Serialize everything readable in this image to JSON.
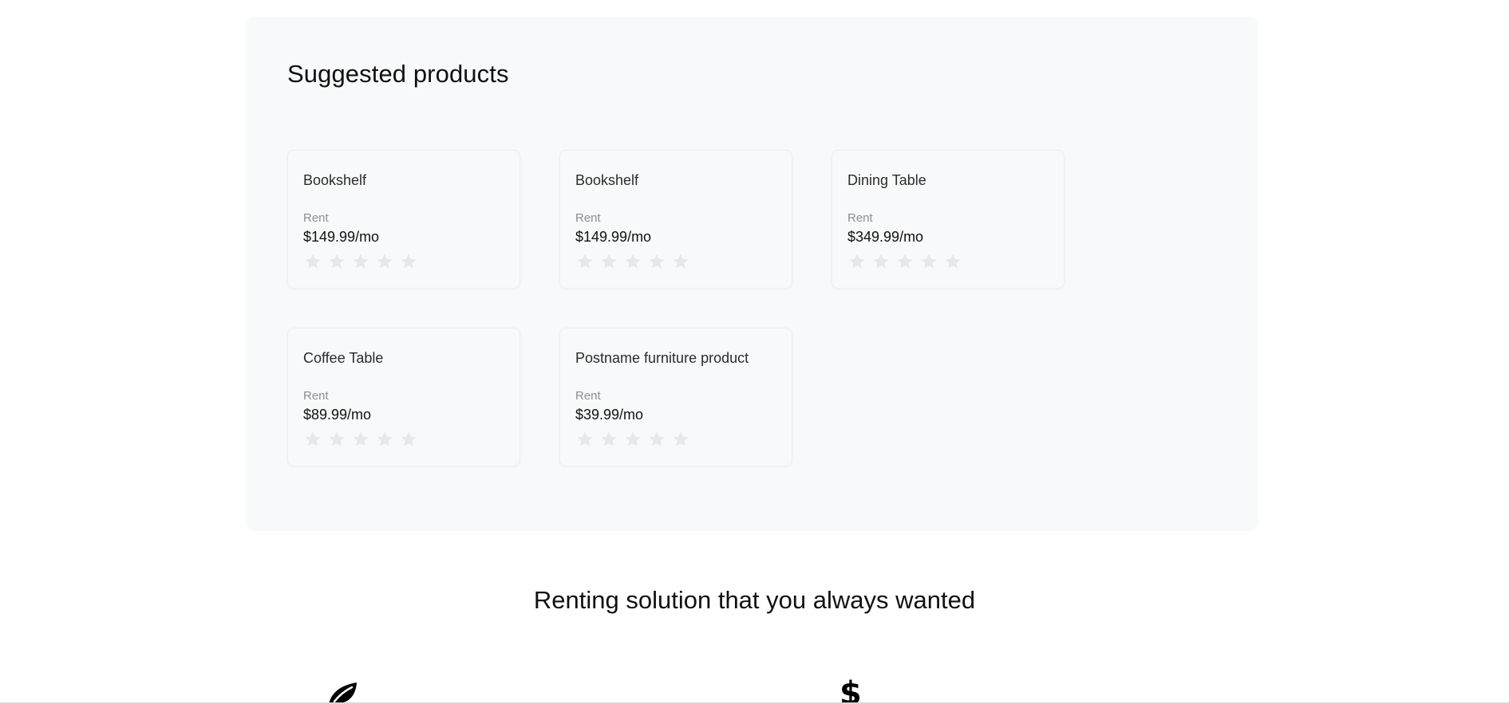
{
  "suggested": {
    "title": "Suggested products",
    "products": [
      {
        "name": "Bookshelf",
        "mode": "Rent",
        "price": "$149.99/mo",
        "rating": 0
      },
      {
        "name": "Bookshelf",
        "mode": "Rent",
        "price": "$149.99/mo",
        "rating": 0
      },
      {
        "name": "Dining Table",
        "mode": "Rent",
        "price": "$349.99/mo",
        "rating": 0
      },
      {
        "name": "Coffee Table",
        "mode": "Rent",
        "price": "$89.99/mo",
        "rating": 0
      },
      {
        "name": "Postname furniture product",
        "mode": "Rent",
        "price": "$39.99/mo",
        "rating": 0
      }
    ]
  },
  "renting": {
    "heading": "Renting solution that you always wanted",
    "features": [
      {
        "icon": "leaf-icon"
      },
      {
        "icon": "dollar-icon",
        "glyph": "$"
      }
    ]
  },
  "colors": {
    "panel_bg": "#f8f9fa",
    "star_empty": "#e6e8eb",
    "muted_text": "#8a8f96"
  }
}
